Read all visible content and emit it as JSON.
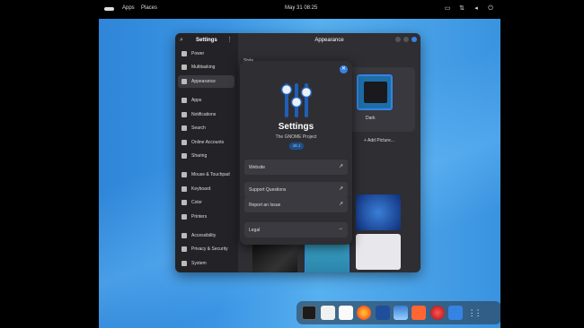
{
  "topbar": {
    "apps": "Apps",
    "places": "Places",
    "clock": "May 31  08:25",
    "tray_icons": [
      "window-icon",
      "network-icon",
      "volume-icon",
      "power-icon"
    ]
  },
  "settings": {
    "sidebar_title": "Settings",
    "main_title": "Appearance",
    "items": [
      {
        "label": "Power",
        "icon": "power-icon"
      },
      {
        "label": "Multitasking",
        "icon": "multitasking-icon"
      },
      {
        "label": "Appearance",
        "icon": "appearance-icon",
        "active": true
      },
      {
        "label": "Apps",
        "icon": "apps-icon"
      },
      {
        "label": "Notifications",
        "icon": "bell-icon"
      },
      {
        "label": "Search",
        "icon": "search-icon"
      },
      {
        "label": "Online Accounts",
        "icon": "accounts-icon"
      },
      {
        "label": "Sharing",
        "icon": "share-icon"
      },
      {
        "label": "Mouse & Touchpad",
        "icon": "mouse-icon"
      },
      {
        "label": "Keyboard",
        "icon": "keyboard-icon"
      },
      {
        "label": "Color",
        "icon": "color-icon"
      },
      {
        "label": "Printers",
        "icon": "printer-icon"
      },
      {
        "label": "Accessibility",
        "icon": "accessibility-icon"
      },
      {
        "label": "Privacy & Security",
        "icon": "hand-icon"
      },
      {
        "label": "System",
        "icon": "gear-icon"
      }
    ],
    "style_label": "Style",
    "dark_label": "Dark",
    "add_picture": "+ Add Picture..."
  },
  "about": {
    "title": "Settings",
    "subtitle": "The GNOME Project",
    "version": "48.1",
    "rows": [
      {
        "label": "Website",
        "arrow": "↗"
      },
      {
        "label": "Support Questions",
        "arrow": "↗"
      },
      {
        "label": "Report an Issue",
        "arrow": "↗"
      },
      {
        "label": "Legal",
        "arrow": "→"
      }
    ]
  },
  "dock": {
    "icons": [
      "terminal-icon",
      "text-editor-icon",
      "document-viewer-icon",
      "firefox-icon",
      "metasploit-icon",
      "wireshark-icon",
      "burpsuite-icon",
      "ruby-icon",
      "settings-app-icon",
      "app-grid-icon"
    ]
  },
  "colors": {
    "accent": "#3584e4",
    "window_bg": "#2b2b2f"
  }
}
